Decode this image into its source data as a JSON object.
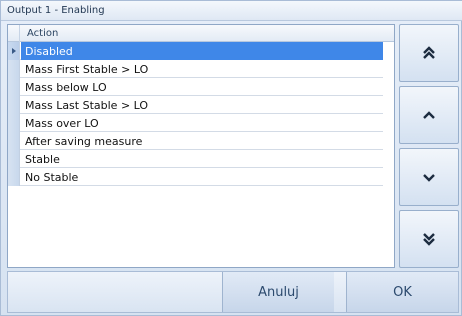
{
  "window": {
    "title": "Output 1 - Enabling"
  },
  "grid": {
    "column_header": "Action",
    "selected_index": 0,
    "rows": [
      "Disabled",
      "Mass First Stable > LO",
      "Mass below LO",
      "Mass Last Stable > LO",
      "Mass over LO",
      "After saving measure",
      "Stable",
      "No Stable"
    ]
  },
  "nav": {
    "buttons": [
      "double-chevron-up-icon",
      "chevron-up-icon",
      "chevron-down-icon",
      "double-chevron-down-icon"
    ]
  },
  "footer": {
    "cancel_label": "Anuluj",
    "ok_label": "OK"
  },
  "colors": {
    "selection": "#3f87e8",
    "accent_text": "#2c4a6e"
  }
}
